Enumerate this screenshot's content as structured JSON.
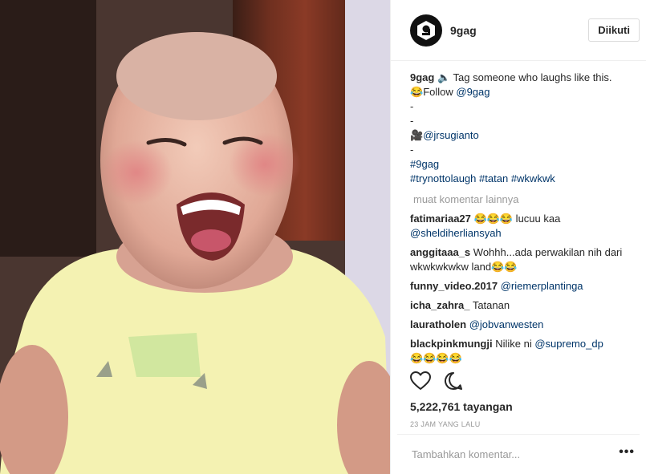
{
  "post": {
    "username": "9gag",
    "follow_label": "Diikuti",
    "caption": {
      "author": "9gag",
      "line1": "🔈 Tag someone who laughs like this.",
      "line2_icon": "😂",
      "line2_text": "Follow ",
      "line2_link": "@9gag",
      "line3": "-",
      "line4": "-",
      "line5_icon": "🎥",
      "line5_link": "@jrsugianto",
      "line6": "-",
      "line7_link": "#9gag",
      "line8_link1": "#trynottolaugh",
      "line8_link2": "#tatan",
      "line8_link3": "#wkwkwk"
    },
    "load_more": "muat komentar lainnya",
    "comments": [
      {
        "user": "fatimariaa27",
        "text": "😂😂😂 lucuu kaa",
        "link": "@sheldiherliansyah"
      },
      {
        "user": "anggitaaa_s",
        "text": "Wohhh...ada perwakilan nih dari wkwkwkwkw land😂😂",
        "link": ""
      },
      {
        "user": "funny_video.2017",
        "text": "",
        "link": "@riemerplantinga"
      },
      {
        "user": "icha_zahra_",
        "text": "Tatanan",
        "link": ""
      },
      {
        "user": "lauratholen",
        "text": "",
        "link": "@jobvanwesten"
      },
      {
        "user": "blackpinkmungji",
        "text": "Nilike ni ",
        "link": "@supremo_dp",
        "extra": "😂😂😂😂"
      }
    ],
    "views": "5,222,761 tayangan",
    "time_ago": "23 JAM YANG LALU",
    "comment_placeholder": "Tambahkan komentar...",
    "options_icon": "more-options-icon",
    "icons": [
      "heart-icon",
      "comment-bubble-icon"
    ]
  }
}
